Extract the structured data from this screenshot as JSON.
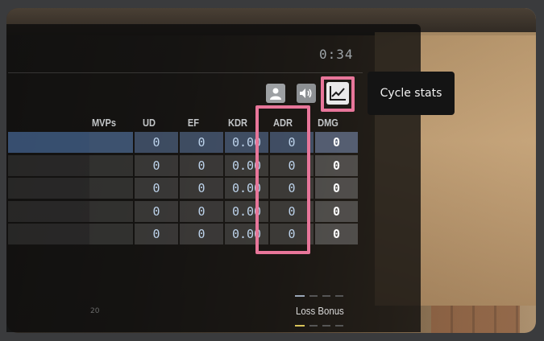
{
  "timer": "0:34",
  "toolbar": {
    "player_icon": "person-icon",
    "sound_icon": "speaker-icon",
    "stats_icon": "line-chart-icon"
  },
  "tooltip": "Cycle stats",
  "columns": [
    "MVPs",
    "UD",
    "EF",
    "KDR",
    "ADR",
    "DMG"
  ],
  "rows": [
    {
      "mvps": "",
      "ud": "0",
      "ef": "0",
      "kdr": "0.00",
      "adr": "0",
      "dmg": "0"
    },
    {
      "mvps": "",
      "ud": "0",
      "ef": "0",
      "kdr": "0.00",
      "adr": "0",
      "dmg": "0"
    },
    {
      "mvps": "",
      "ud": "0",
      "ef": "0",
      "kdr": "0.00",
      "adr": "0",
      "dmg": "0"
    },
    {
      "mvps": "",
      "ud": "0",
      "ef": "0",
      "kdr": "0.00",
      "adr": "0",
      "dmg": "0"
    },
    {
      "mvps": "",
      "ud": "0",
      "ef": "0",
      "kdr": "0.00",
      "adr": "0",
      "dmg": "0"
    }
  ],
  "footer": {
    "loss_bonus": "Loss Bonus",
    "tick": "20"
  },
  "colors": {
    "highlight": "#e8769a",
    "selected_row": "#5f87be",
    "value_text": "#bcd2ea"
  }
}
